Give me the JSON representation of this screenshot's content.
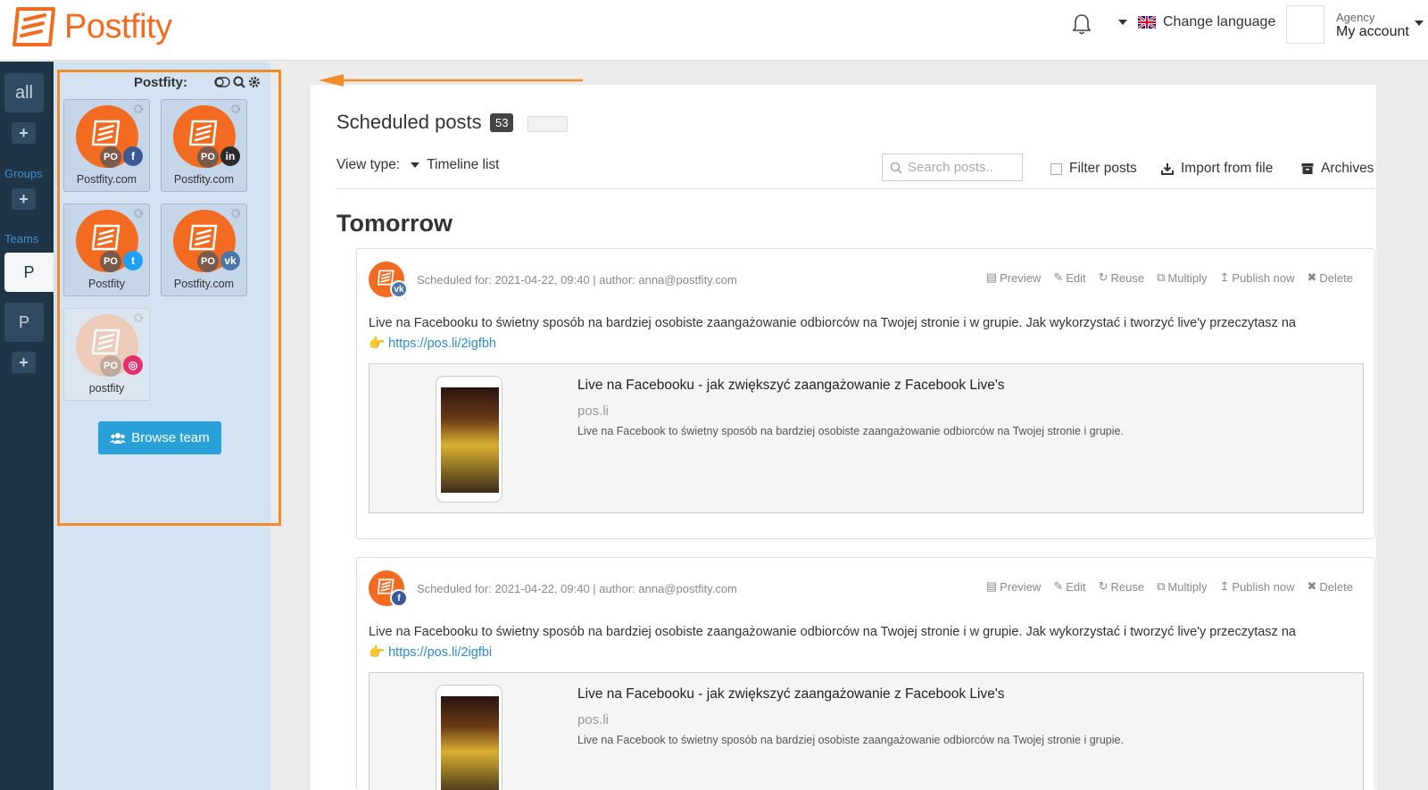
{
  "header": {
    "brand": "Postfity",
    "language_label": "Change language",
    "account_role": "Agency",
    "account_label": "My account"
  },
  "rail": {
    "all_label": "all",
    "groups_label": "Groups",
    "teams_label": "Teams",
    "team_active": "P",
    "team_other": "P",
    "plus": "+"
  },
  "panel": {
    "title": "Postfity:",
    "accounts": [
      {
        "name": "Postfity.com",
        "network": "facebook",
        "badge": "PO"
      },
      {
        "name": "Postfity.com",
        "network": "linkedin",
        "badge": "PO"
      },
      {
        "name": "Postfity",
        "network": "twitter",
        "badge": "PO"
      },
      {
        "name": "Postfity.com",
        "network": "vk",
        "badge": "PO"
      },
      {
        "name": "postfity",
        "network": "instagram",
        "badge": "PO"
      }
    ],
    "browse_label": "Browse team"
  },
  "main": {
    "title": "Scheduled posts",
    "count": "53",
    "view_type_label": "View type:",
    "view_type_value": "Timeline list",
    "search_placeholder": "Search posts..",
    "filter_label": "Filter posts",
    "import_label": "Import from file",
    "archives_label": "Archives",
    "day_heading": "Tomorrow"
  },
  "actions": {
    "preview": "Preview",
    "edit": "Edit",
    "reuse": "Reuse",
    "multiply": "Multiply",
    "publish": "Publish now",
    "delete": "Delete"
  },
  "posts": [
    {
      "network": "vk",
      "meta": "Scheduled for: 2021-04-22, 09:40 | author: anna@postfity.com",
      "text": "Live na Facebooku to świetny sposób na bardziej osobiste zaangażowanie odbiorców na Twojej stronie i w grupie. Jak wykorzystać i tworzyć live'y przeczytasz na",
      "link": "https://pos.li/2igfbh",
      "preview_title": "Live na Facebooku - jak zwiększyć zaangażowanie z Facebook Live's",
      "preview_domain": "pos.li",
      "preview_desc": "Live na Facebook to świetny sposób na bardziej osobiste zaangażowanie odbiorców na Twojej stronie i grupie."
    },
    {
      "network": "facebook",
      "meta": "Scheduled for: 2021-04-22, 09:40 | author: anna@postfity.com",
      "text": "Live na Facebooku to świetny sposób na bardziej osobiste zaangażowanie odbiorców na Twojej stronie i w grupie. Jak wykorzystać i tworzyć live'y przeczytasz na",
      "link": "https://pos.li/2igfbi",
      "preview_title": "Live na Facebooku - jak zwiększyć zaangażowanie z Facebook Live's",
      "preview_domain": "pos.li",
      "preview_desc": "Live na Facebook to świetny sposób na bardziej osobiste zaangażowanie odbiorców na Twojej stronie i grupie."
    }
  ],
  "colors": {
    "brand": "#f26b21",
    "rail": "#1f3447",
    "panel": "#d3e3f2",
    "highlight": "#f28c28",
    "button": "#2aa0d8",
    "facebook": "#3b5998",
    "linkedin": "#2c2c2c",
    "twitter": "#1da1f2",
    "vk": "#4a76a8",
    "instagram": "#e1306c"
  }
}
